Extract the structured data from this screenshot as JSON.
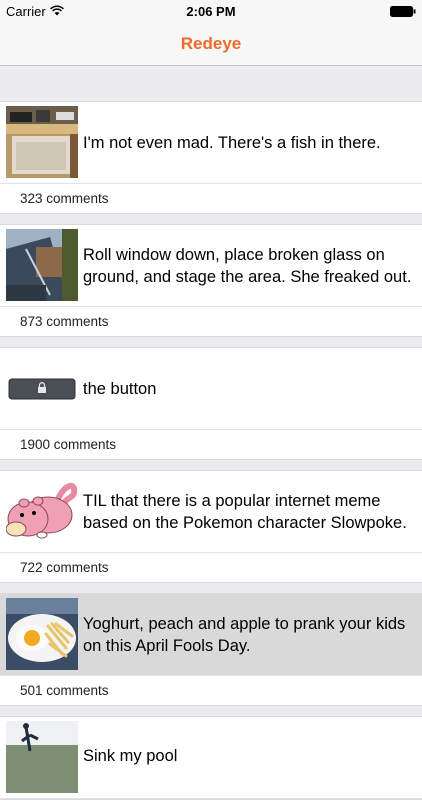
{
  "status_bar": {
    "carrier": "Carrier",
    "time": "2:06 PM"
  },
  "nav": {
    "title": "Redeye"
  },
  "posts": [
    {
      "title": "I'm not even mad. There's a fish in there.",
      "comments": "323 comments"
    },
    {
      "title": "Roll window down, place broken glass on ground, and stage the area. She freaked out.",
      "comments": "873 comments"
    },
    {
      "title": "the button",
      "comments": "1900 comments"
    },
    {
      "title": "TIL that there is a popular internet meme based on the Pokemon character Slowpoke.",
      "comments": "722 comments"
    },
    {
      "title": "Yoghurt, peach and apple to prank your kids on this April Fools Day.",
      "comments": "501 comments"
    },
    {
      "title": "Sink my pool",
      "comments": ""
    }
  ],
  "colors": {
    "accent": "#f26a2a",
    "background": "#ececef",
    "pressed_row": "#d9d9d9"
  },
  "icons": {
    "wifi": "wifi-icon",
    "battery": "battery-icon",
    "lock": "lock-icon"
  }
}
